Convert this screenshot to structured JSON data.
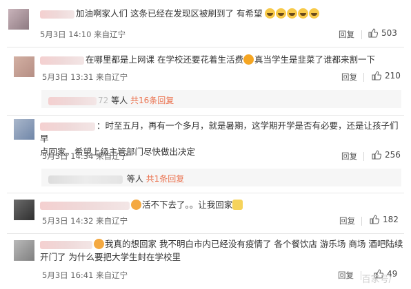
{
  "comments": [
    {
      "text": "加油啊家人们 这条已经在发现区被刷到了 有希望",
      "time": "5月3日 14:10 来自辽宁",
      "reply": "回复",
      "likes": "503"
    },
    {
      "text": "在哪里都是上网课 在学校还要花着生活费",
      "text2": "真当学生是韭菜了谁都来割一下",
      "time": "5月3日 13:31 来自辽宁",
      "reply": "回复",
      "likes": "210",
      "sub_suffix": "72",
      "sub_others": "等人",
      "sub_count": "共16条回复"
    },
    {
      "text": "：时至五月，再有一个多月，就是暑期，这学期开学是否有必要，还是让孩子们早",
      "text_line2": "点回家，希望上级主管部门尽快做出决定",
      "time": "5月3日 14:34 来自辽宁",
      "reply": "回复",
      "likes": "256",
      "sub_others": "等人",
      "sub_count": "共1条回复"
    },
    {
      "text": "活不下去了。。让我回家",
      "time": "5月3日 14:32 来自辽宁",
      "reply": "回复",
      "likes": "182"
    },
    {
      "text": "我真的想回家 我不明白市内已经没有疫情了 各个餐饮店 游乐场 商场 酒吧陆续",
      "text_line2": "开门了 为什么要把大学生封在学校里",
      "time": "5月3日 16:41 来自辽宁",
      "reply": "回复",
      "likes": "49"
    }
  ],
  "watermark": "百家号/",
  "colors": {
    "accent": "#eb7350",
    "separator": "#e6e6e6",
    "subbox": "#f6f6f6"
  }
}
